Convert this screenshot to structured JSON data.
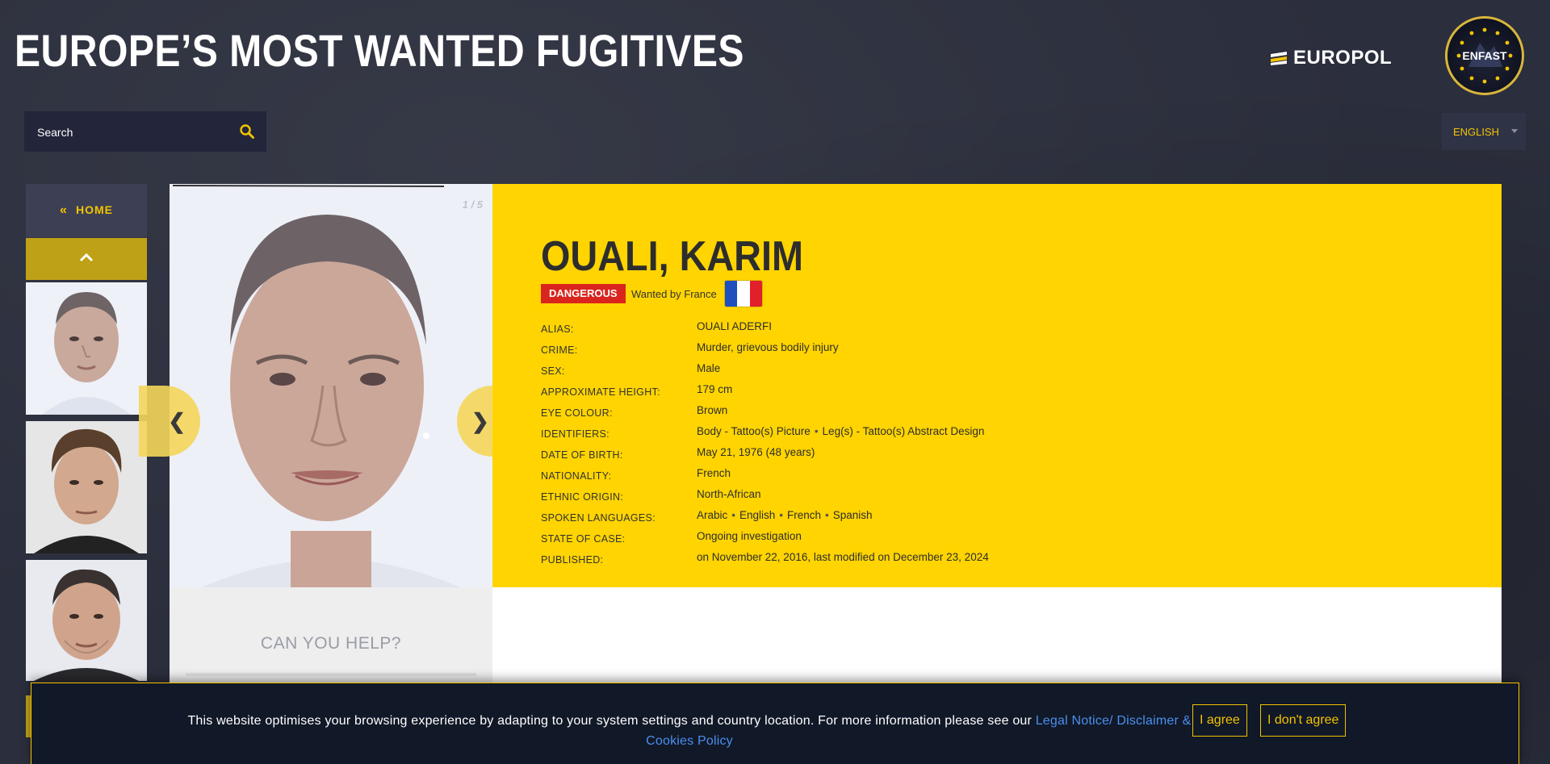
{
  "header": {
    "title": "EUROPE’S MOST WANTED FUGITIVES",
    "europol_logo_text": "EUROPOL",
    "enfast_logo_text": "ENFAST"
  },
  "search": {
    "placeholder": "Search"
  },
  "language": {
    "selected": "ENGLISH"
  },
  "sidebar": {
    "home_label": "HOME",
    "home_arrows": "«",
    "thumbnails": [
      {
        "icon": "portrait-bald-man"
      },
      {
        "icon": "portrait-brown-hair-man"
      },
      {
        "icon": "portrait-short-hair-man"
      }
    ]
  },
  "photo": {
    "counter": "1 / 5"
  },
  "navigation": {
    "prev": "❮",
    "next": "❯"
  },
  "fugitive": {
    "name": "OUALI, KARIM",
    "danger_badge": "DANGEROUS",
    "wanted_by": "Wanted by France",
    "flag_colors": [
      "#1f4fbf",
      "#ffffff",
      "#e1202b"
    ],
    "fields": [
      {
        "label": "Alias:",
        "value": "OUALI ADERFI"
      },
      {
        "label": "Crime:",
        "value": "Murder, grievous bodily injury"
      },
      {
        "label": "Sex:",
        "value": "Male"
      },
      {
        "label": "Approximate height:",
        "value": "179 cm"
      },
      {
        "label": "Eye colour:",
        "value": "Brown"
      },
      {
        "label": "Identifiers:",
        "value_parts": [
          "Body - Tattoo(s) Picture",
          "Leg(s) - Tattoo(s) Abstract Design"
        ]
      },
      {
        "label": "Date of birth:",
        "value": "May 21, 1976 (48 years)"
      },
      {
        "label": "Nationality:",
        "value": "French"
      },
      {
        "label": "Ethnic origin:",
        "value": "North-African"
      },
      {
        "label": "Spoken languages:",
        "value_parts": [
          "Arabic",
          "English",
          "French",
          "Spanish"
        ]
      },
      {
        "label": "State of case:",
        "value": "Ongoing investigation"
      },
      {
        "label": "Published:",
        "value": "on November 22, 2016, last modified on December 23, 2024"
      }
    ]
  },
  "help": {
    "title": "CAN YOU HELP?"
  },
  "cookie": {
    "text": "This website optimises your browsing experience by adapting to your system settings and country location. For more information please see our ",
    "link": "Legal Notice/ Disclaimer & Cookies Policy",
    "agree": "I agree",
    "disagree": "I don't agree"
  },
  "colors": {
    "accent_yellow": "#ffd400",
    "danger_red": "#d9251d",
    "background": "#2b2e3c",
    "link_blue": "#4a90f0"
  }
}
